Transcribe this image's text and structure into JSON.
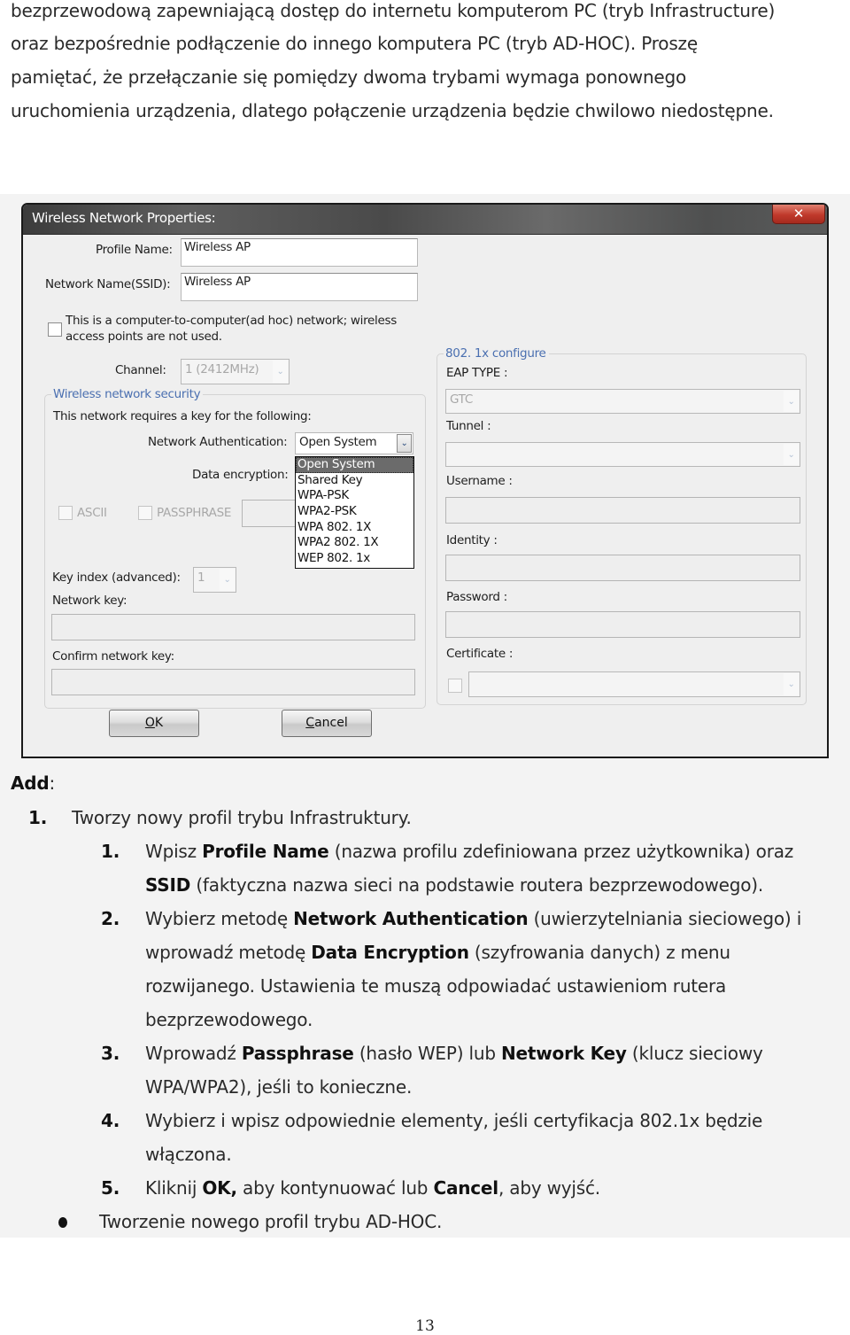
{
  "intro": {
    "lines": [
      "bezprzewodową zapewniającą dostęp do internetu komputerom PC (tryb Infrastructure)",
      "oraz bezpośrednie podłączenie do innego komputera PC (tryb AD-HOC).   Proszę",
      "pamiętać, że przełączanie się pomiędzy dwoma trybami wymaga ponownego",
      "uruchomienia urządzenia, dlatego połączenie urządzenia będzie chwilowo niedostępne."
    ]
  },
  "dialog": {
    "title": "Wireless Network Properties:",
    "close_icon": "✕",
    "profile_name_label": "Profile Name:",
    "profile_name_value": "Wireless AP",
    "ssid_label": "Network Name(SSID):",
    "ssid_value": "Wireless AP",
    "adhoc_checkbox_label_1": "This is a computer-to-computer(ad hoc) network; wireless",
    "adhoc_checkbox_label_2": "access points are not used.",
    "adhoc_checked": false,
    "channel_label": "Channel:",
    "channel_value": "1  (2412MHz)",
    "security": {
      "legend": "Wireless network security",
      "requires_key_label": "This network requires a key for the following:",
      "auth_label": "Network Authentication:",
      "auth_value": "Open System",
      "auth_options": [
        "Open System",
        "Shared Key",
        "WPA-PSK",
        "WPA2-PSK",
        "WPA 802. 1X",
        "WPA2 802. 1X",
        "WEP 802. 1x"
      ],
      "auth_selected_index": 0,
      "encryption_label": "Data encryption:",
      "ascii_label": "ASCII",
      "passphrase_label": "PASSPHRASE",
      "key_index_label": "Key index (advanced):",
      "key_index_value": "1",
      "network_key_label": "Network key:",
      "confirm_key_label": "Confirm network key:"
    },
    "dot1x": {
      "legend": "802. 1x configure",
      "eap_type_label": "EAP TYPE :",
      "eap_type_value": "GTC",
      "tunnel_label": "Tunnel :",
      "username_label": "Username :",
      "identity_label": "Identity :",
      "password_label": "Password :",
      "certificate_label": "Certificate :"
    },
    "ok_label_mnemonic": "O",
    "ok_label_rest": "K",
    "cancel_label_mnemonic": "C",
    "cancel_label_rest": "ancel",
    "arrow_icon": "⌄"
  },
  "instructions": {
    "heading_bold": "Add",
    "heading_colon": ":",
    "item1_num": "1.",
    "item1_text": "Tworzy nowy profil trybu Infrastruktury.",
    "steps": [
      {
        "num": "1.",
        "l1_a": "Wpisz ",
        "l1_b": "Profile Name",
        "l1_c": " (nazwa profilu zdefiniowana przez użytkownika) oraz",
        "l2_a": "",
        "l2_b": "SSID",
        "l2_c": " (faktyczna nazwa sieci na podstawie routera bezprzewodowego)."
      },
      {
        "num": "2.",
        "l1_a": "Wybierz metodę ",
        "l1_b": "Network Authentication",
        "l1_c": " (uwierzytelniania sieciowego) i",
        "l2_a": "wprowadź metodę ",
        "l2_b": "Data Encryption",
        "l2_c": " (szyfrowania danych) z menu",
        "l3": "rozwijanego. Ustawienia te muszą odpowiadać ustawieniom rutera",
        "l4": "bezprzewodowego."
      },
      {
        "num": "3.",
        "l1_a": "Wprowadź ",
        "l1_b": "Passphrase",
        "l1_c": " (hasło WEP) lub ",
        "l1_d": "Network Key",
        "l1_e": " (klucz sieciowy",
        "l2": "WPA/WPA2), jeśli to konieczne."
      },
      {
        "num": "4.",
        "l1": "Wybierz i wpisz odpowiednie elementy, jeśli certyfikacja 802.1x będzie",
        "l2": "włączona."
      },
      {
        "num": "5.",
        "l1_a": "Kliknij ",
        "l1_b": "OK,",
        "l1_c": " aby kontynuować lub ",
        "l1_d": "Cancel",
        "l1_e": ", aby wyjść."
      }
    ],
    "bullet_text": "Tworzenie nowego profil trybu AD-HOC."
  },
  "page_number": "13"
}
